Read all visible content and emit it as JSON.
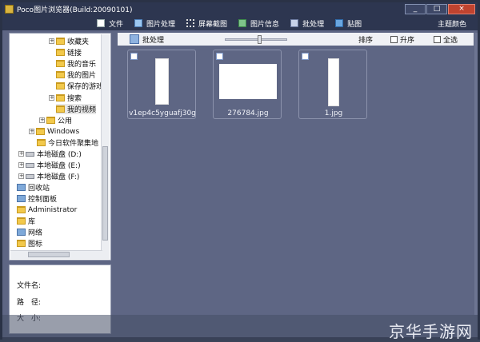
{
  "window": {
    "title": "Poco图片浏览器(Build:20090101)",
    "controls": {
      "minimize": "_",
      "maximize": "□",
      "close": "×"
    }
  },
  "toolbar": {
    "items": [
      {
        "label": "文件",
        "icon": "file-icon"
      },
      {
        "label": "图片处理",
        "icon": "image-edit-icon"
      },
      {
        "label": "屏幕截图",
        "icon": "screenshot-icon"
      },
      {
        "label": "图片信息",
        "icon": "image-info-icon"
      },
      {
        "label": "批处理",
        "icon": "batch-icon"
      },
      {
        "label": "贴图",
        "icon": "paste-image-icon"
      }
    ],
    "theme_label": "主题颜色"
  },
  "tree": {
    "items": [
      {
        "label": "收藏夹",
        "icon": "folder",
        "expander": "+"
      },
      {
        "label": "链接",
        "icon": "folder",
        "expander": ""
      },
      {
        "label": "我的音乐",
        "icon": "folder",
        "expander": ""
      },
      {
        "label": "我的图片",
        "icon": "folder",
        "expander": ""
      },
      {
        "label": "保存的游戏",
        "icon": "folder",
        "expander": ""
      },
      {
        "label": "搜索",
        "icon": "folder",
        "expander": "+"
      },
      {
        "label": "我的视频",
        "icon": "folder",
        "expander": ""
      },
      {
        "label": "公用",
        "icon": "folder",
        "expander": "+"
      },
      {
        "label": "Windows",
        "icon": "folder",
        "expander": "+"
      },
      {
        "label": "今日软件聚集地",
        "icon": "folder",
        "expander": ""
      },
      {
        "label": "本地磁盘 (D:)",
        "icon": "drive",
        "expander": "+"
      },
      {
        "label": "本地磁盘 (E:)",
        "icon": "drive",
        "expander": "+"
      },
      {
        "label": "本地磁盘 (F:)",
        "icon": "drive",
        "expander": "+"
      },
      {
        "label": "回收站",
        "icon": "recycle-bin",
        "expander": ""
      },
      {
        "label": "控制面板",
        "icon": "control-panel",
        "expander": ""
      },
      {
        "label": "Administrator",
        "icon": "user",
        "expander": ""
      },
      {
        "label": "库",
        "icon": "library",
        "expander": ""
      },
      {
        "label": "网络",
        "icon": "network",
        "expander": ""
      },
      {
        "label": "图标",
        "icon": "folder",
        "expander": ""
      }
    ]
  },
  "info": {
    "filename_label": "文件名:",
    "path_label": "路　径:",
    "size_label": "大　小:"
  },
  "grid_toolbar": {
    "batch_label": "批处理",
    "sort_label": "排序",
    "ascending_label": "升序",
    "select_all_label": "全选",
    "ascending_checked": false,
    "select_all_checked": false
  },
  "thumbnails": [
    {
      "filename": "v1ep4c5yguafj30g",
      "kind": "document"
    },
    {
      "filename": "276784.jpg",
      "kind": "anime"
    },
    {
      "filename": "1.jpg",
      "kind": "document"
    }
  ],
  "watermark": "京华手游网",
  "colors": {
    "chrome": "#2d3650",
    "pane_background": "#5e6684",
    "folder": "#f2c94c"
  }
}
